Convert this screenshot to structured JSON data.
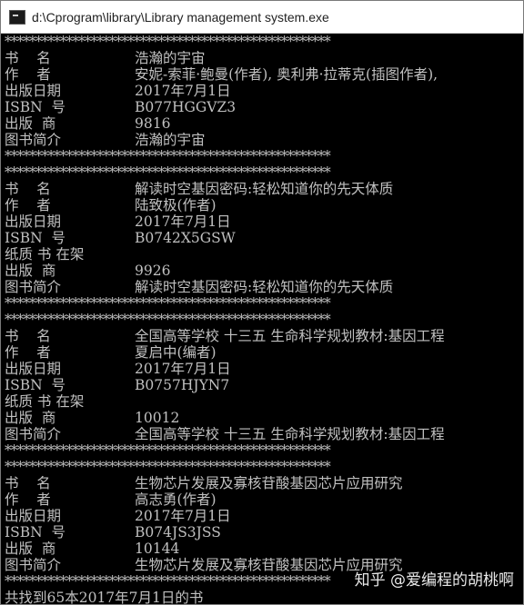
{
  "window": {
    "title": "d:\\Cprogram\\library\\Library management system.exe",
    "icon": "console-app-icon"
  },
  "console": {
    "separator": "*****************************************************",
    "records": [
      {
        "rows": [
          {
            "label": "书    名",
            "value": "浩瀚的宇宙"
          },
          {
            "label": "作    者",
            "value": "安妮-索菲·鲍曼(作者), 奥利弗·拉蒂克(插图作者),"
          },
          {
            "label": "出版日期",
            "value": "2017年7月1日"
          },
          {
            "label": "ISBN  号",
            "value": "B077HGGVZ3"
          },
          {
            "label": "出版  商",
            "value": "9816"
          },
          {
            "label": "图书简介",
            "value": "浩瀚的宇宙"
          }
        ]
      },
      {
        "rows": [
          {
            "label": "书    名",
            "value": "解读时空基因密码:轻松知道你的先天体质"
          },
          {
            "label": "作    者",
            "value": "陆致极(作者)"
          },
          {
            "label": "出版日期",
            "value": "2017年7月1日"
          },
          {
            "label": "ISBN  号",
            "value": "B0742X5GSW"
          },
          {
            "label": "纸质 书 在架",
            "value": ""
          },
          {
            "label": "出版  商",
            "value": "9926"
          },
          {
            "label": "图书简介",
            "value": "解读时空基因密码:轻松知道你的先天体质"
          }
        ]
      },
      {
        "rows": [
          {
            "label": "书    名",
            "value": "全国高等学校 十三五 生命科学规划教材:基因工程"
          },
          {
            "label": "作    者",
            "value": "夏启中(编者)"
          },
          {
            "label": "出版日期",
            "value": "2017年7月1日"
          },
          {
            "label": "ISBN  号",
            "value": "B0757HJYN7"
          },
          {
            "label": "纸质 书 在架",
            "value": ""
          },
          {
            "label": "出版  商",
            "value": "10012"
          },
          {
            "label": "图书简介",
            "value": "全国高等学校 十三五 生命科学规划教材:基因工程"
          }
        ]
      },
      {
        "rows": [
          {
            "label": "书    名",
            "value": "生物芯片发展及寡核苷酸基因芯片应用研究"
          },
          {
            "label": "作    者",
            "value": "高志勇(作者)"
          },
          {
            "label": "出版日期",
            "value": "2017年7月1日"
          },
          {
            "label": "ISBN  号",
            "value": "B074JS3JSS"
          },
          {
            "label": "出版  商",
            "value": "10144"
          },
          {
            "label": "图书简介",
            "value": "生物芯片发展及寡核苷酸基因芯片应用研究"
          }
        ]
      }
    ],
    "summary": "共找到65本2017年7月1日的书"
  },
  "watermark": {
    "text": "知乎 @爱编程的胡桃啊"
  }
}
